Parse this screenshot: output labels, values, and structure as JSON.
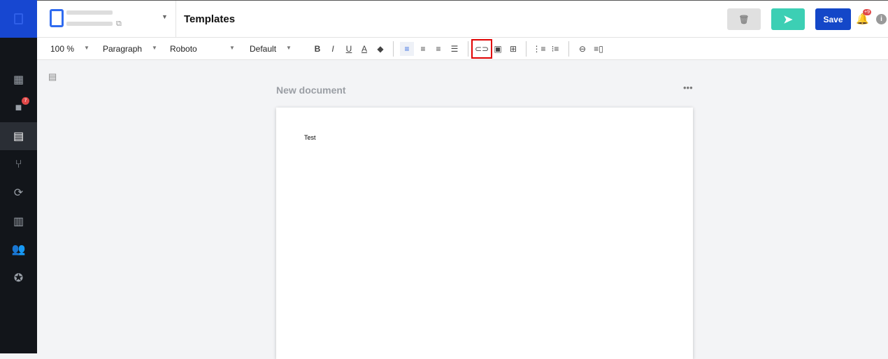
{
  "sidebar": {
    "items": [
      "dashboard-icon",
      "folder-icon",
      "document-icon",
      "fork-icon",
      "sync-icon",
      "library-icon",
      "people-icon",
      "verified-icon"
    ],
    "folder_badge": "7",
    "active": "document-icon"
  },
  "header": {
    "title": "Templates",
    "save_label": "Save",
    "notification_badge": "+9"
  },
  "toolbar": {
    "zoom": "100 %",
    "block": "Paragraph",
    "font": "Roboto",
    "size": "Default"
  },
  "document": {
    "name": "New document",
    "body": "Test"
  },
  "colors": {
    "accent": "#1447c8",
    "send": "#3ccfb4",
    "highlight": "#e00000"
  }
}
